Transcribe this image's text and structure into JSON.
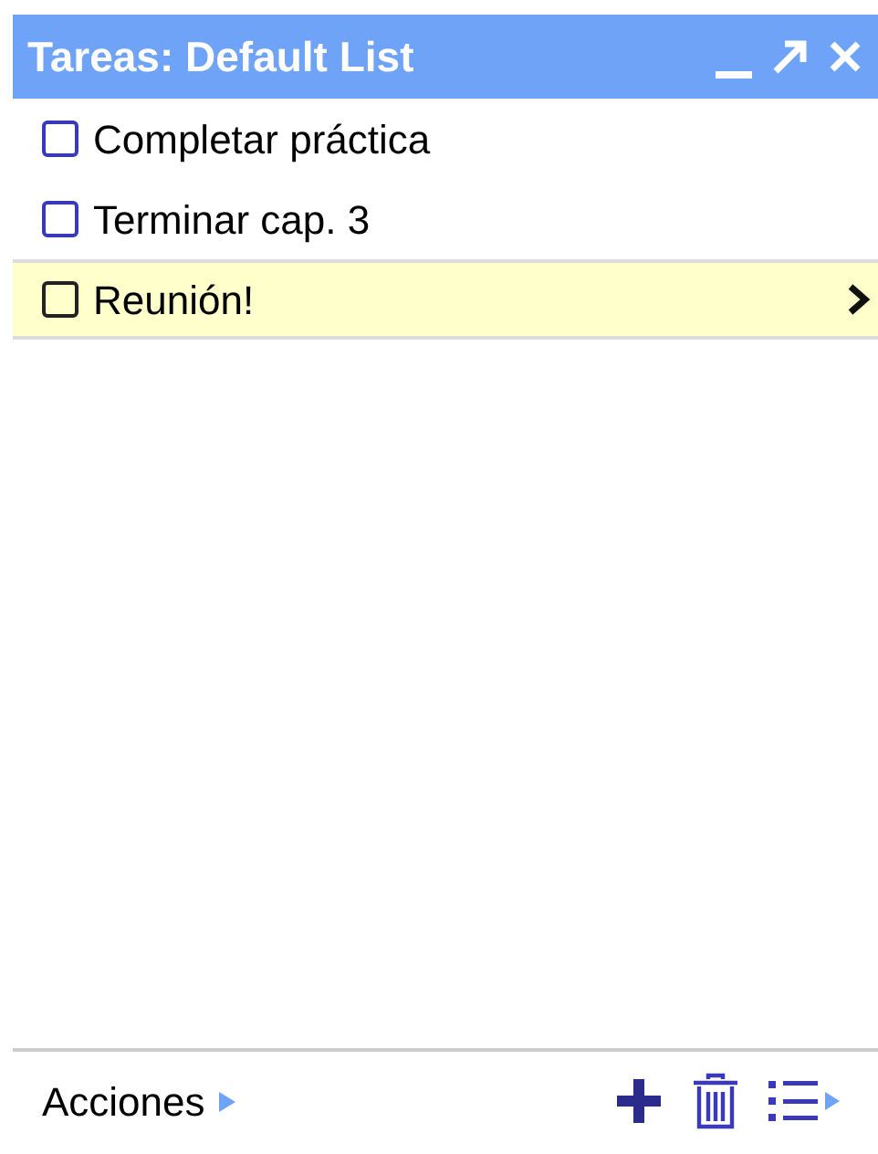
{
  "window": {
    "title": "Tareas: Default List"
  },
  "tasks": [
    {
      "text": "Completar práctica",
      "checked": false,
      "selected": false
    },
    {
      "text": "Terminar cap. 3",
      "checked": false,
      "selected": false
    },
    {
      "text": "Reunión!",
      "checked": false,
      "selected": true
    }
  ],
  "footer": {
    "actions_label": "Acciones"
  }
}
